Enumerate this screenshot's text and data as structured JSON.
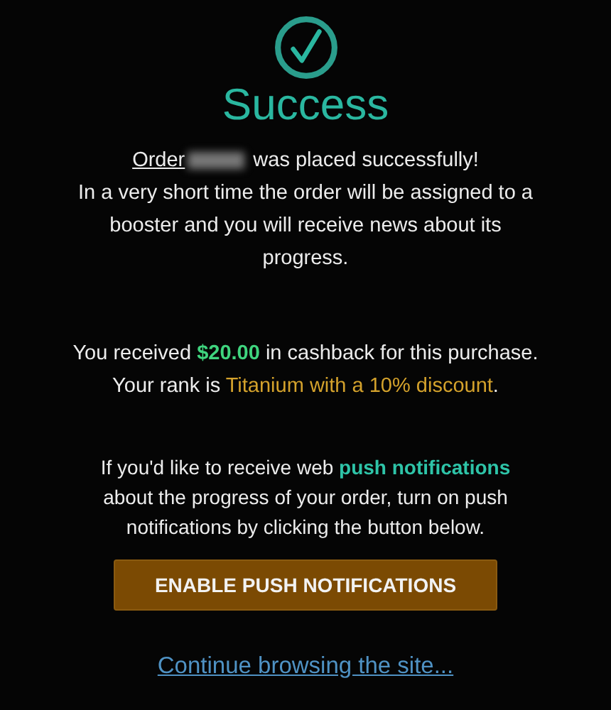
{
  "title": "Success",
  "order_line": {
    "link": "Order",
    "redacted": true,
    "rest": " was placed successfully!"
  },
  "paragraphs": [
    {
      "segments": [
        {
          "kind": "plain",
          "text": "In a very short time the order will be assigned to a booster and you will receive news about its progress."
        }
      ]
    },
    {
      "segments": [
        {
          "kind": "plain",
          "text": "You received "
        },
        {
          "kind": "money",
          "text": "$20.00"
        },
        {
          "kind": "plain",
          "text": " in cashback for this purchase. Your rank is "
        },
        {
          "kind": "rank",
          "text": "Titanium with a 10% discount"
        },
        {
          "kind": "plain",
          "text": "."
        }
      ]
    },
    {
      "segments": [
        {
          "kind": "plain",
          "text": "If you'd like to receive web "
        },
        {
          "kind": "highlight",
          "text": "push notifications"
        },
        {
          "kind": "plain",
          "text": " about the progress of your order, turn on push notifications by clicking the button below."
        }
      ]
    }
  ],
  "button": "ENABLE PUSH NOTIFICATIONS",
  "continue_link": "Continue browsing the site..."
}
